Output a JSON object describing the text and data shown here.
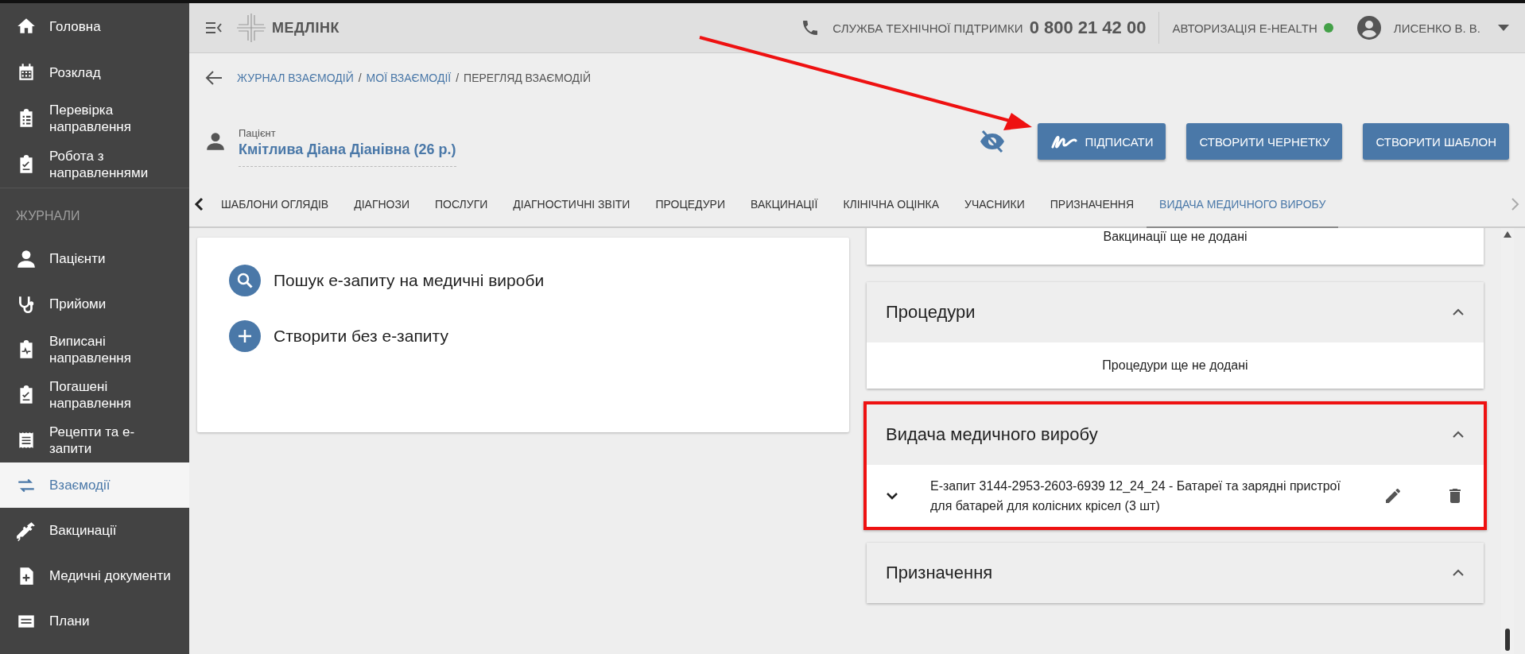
{
  "sidebar": {
    "top_items": [
      {
        "label": "Головна",
        "selected": false
      },
      {
        "label": "Розклад",
        "selected": false
      },
      {
        "label": "Перевірка направлення",
        "selected": false
      },
      {
        "label": "Робота з направленнями",
        "selected": false
      }
    ],
    "section_title": "ЖУРНАЛИ",
    "journal_items": [
      {
        "label": "Пацієнти",
        "selected": false
      },
      {
        "label": "Прийоми",
        "selected": false
      },
      {
        "label": "Виписані направлення",
        "selected": false
      },
      {
        "label": "Погашені направлення",
        "selected": false
      },
      {
        "label": "Рецепти та е-запити",
        "selected": false
      },
      {
        "label": "Взаємодії",
        "selected": true
      },
      {
        "label": "Вакцинації",
        "selected": false
      },
      {
        "label": "Медичні документи",
        "selected": false
      },
      {
        "label": "Плани",
        "selected": false
      }
    ]
  },
  "header": {
    "logo": "МЕДЛІНК",
    "support_label": "СЛУЖБА ТЕХНІЧНОЇ ПІДТРИМКИ",
    "support_phone": "0 800 21 42 00",
    "auth_label": "АВТОРИЗАЦІЯ E-HEALTH",
    "user": "ЛИСЕНКО В. В."
  },
  "breadcrumbs": [
    {
      "label": "ЖУРНАЛ ВЗАЄМОДІЙ",
      "kind": "link"
    },
    {
      "label": "/",
      "kind": "separator"
    },
    {
      "label": "МОЇ ВЗАЄМОДІЇ",
      "kind": "link"
    },
    {
      "label": "/",
      "kind": "separator"
    },
    {
      "label": "ПЕРЕГЛЯД ВЗАЄМОДІЙ",
      "kind": "current"
    }
  ],
  "patient": {
    "label": "Пацієнт",
    "name": "Кмітлива Діана Діанівна (26 р.)"
  },
  "actions": [
    {
      "label": "ПІДПИСАТИ",
      "kind": "sign"
    },
    {
      "label": "СТВОРИТИ ЧЕРНЕТКУ",
      "kind": "plain"
    },
    {
      "label": "СТВОРИТИ ШАБЛОН",
      "kind": "plain"
    }
  ],
  "tabs": [
    {
      "label": "ШАБЛОНИ ОГЛЯДІВ",
      "selected": false
    },
    {
      "label": "ДІАГНОЗИ",
      "selected": false
    },
    {
      "label": "ПОСЛУГИ",
      "selected": false
    },
    {
      "label": "ДІАГНОСТИЧНІ ЗВІТИ",
      "selected": false
    },
    {
      "label": "ПРОЦЕДУРИ",
      "selected": false
    },
    {
      "label": "ВАКЦИНАЦІЇ",
      "selected": false
    },
    {
      "label": "КЛІНІЧНА ОЦІНКА",
      "selected": false
    },
    {
      "label": "УЧАСНИКИ",
      "selected": false
    },
    {
      "label": "ПРИЗНАЧЕННЯ",
      "selected": false
    },
    {
      "label": "ВИДАЧА МЕДИЧНОГО ВИРОБУ",
      "selected": true
    }
  ],
  "options": [
    {
      "label": "Пошук е-запиту на медичні вироби"
    },
    {
      "label": "Створити без е-запиту"
    }
  ],
  "sections": [
    {
      "empty_text": "Вакцинації ще не додані",
      "highlighted": false
    },
    {
      "title": "Процедури",
      "empty_text": "Процедури ще не додані",
      "expanded": true,
      "highlighted": false
    },
    {
      "title": "Видача медичного виробу",
      "expanded": true,
      "highlighted": true,
      "items": [
        {
          "text": "Е-запит 3144-2953-2603-6939 12_24_24 - Батареї та зарядні пристрої для батарей для колісних крісел (3 шт)",
          "expanded": false
        }
      ]
    },
    {
      "title": "Призначення",
      "expanded": true,
      "highlighted": false
    }
  ]
}
